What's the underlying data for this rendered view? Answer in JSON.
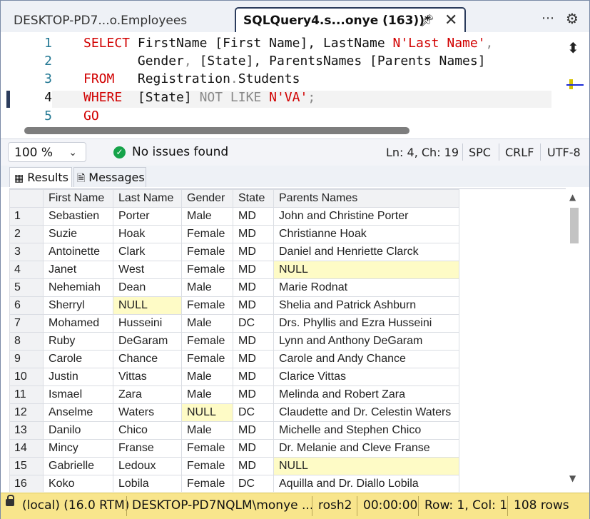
{
  "tabs": {
    "inactive": "DESKTOP-PD7...o.Employees",
    "active": "SQLQuery4.s...onye (163))*"
  },
  "editor": {
    "lines": [
      {
        "num": "1"
      },
      {
        "num": "2"
      },
      {
        "num": "3"
      },
      {
        "num": "4"
      },
      {
        "num": "5"
      }
    ],
    "code": {
      "l1_kw": "SELECT",
      "l1_a": "FirstName [First Name], LastName ",
      "l1_str": "N'Last Name'",
      "l1_comma": ",",
      "l2_a": "Gender",
      "l2_b": ", ",
      "l2_c": "[State], ParentsNames [Parents Names]",
      "l3_kw": "FROM",
      "l3_a": "Registration",
      "l3_dot": ".",
      "l3_b": "Students",
      "l4_kw": "WHERE",
      "l4_a": "[State] ",
      "l4_op": "NOT LIKE ",
      "l4_str": "N'VA'",
      "l4_semi": ";",
      "l5_kw": "GO"
    }
  },
  "status": {
    "zoom": "100 %",
    "issues": "No issues found",
    "position": "Ln: 4, Ch: 19",
    "spacing": "SPC",
    "line_ending": "CRLF",
    "encoding": "UTF-8"
  },
  "result_tabs": {
    "results": "Results",
    "messages": "Messages"
  },
  "grid": {
    "columns": [
      "First Name",
      "Last Name",
      "Gender",
      "State",
      "Parents Names"
    ],
    "rows": [
      [
        "1",
        "Sebastien",
        "Porter",
        "Male",
        "MD",
        "John and Christine Porter"
      ],
      [
        "2",
        "Suzie",
        "Hoak",
        "Female",
        "MD",
        "Christianne Hoak"
      ],
      [
        "3",
        "Antoinette",
        "Clark",
        "Female",
        "MD",
        "Daniel and Henriette Clarck"
      ],
      [
        "4",
        "Janet",
        "West",
        "Female",
        "MD",
        "NULL"
      ],
      [
        "5",
        "Nehemiah",
        "Dean",
        "Male",
        "MD",
        "Marie Rodnat"
      ],
      [
        "6",
        "Sherryl",
        "NULL",
        "Female",
        "MD",
        "Shelia and Patrick Ashburn"
      ],
      [
        "7",
        "Mohamed",
        "Husseini",
        "Male",
        "DC",
        "Drs. Phyllis and Ezra Husseini"
      ],
      [
        "8",
        "Ruby",
        "DeGaram",
        "Female",
        "MD",
        "Lynn and Anthony DeGaram"
      ],
      [
        "9",
        "Carole",
        "Chance",
        "Female",
        "MD",
        "Carole and Andy Chance"
      ],
      [
        "10",
        "Justin",
        "Vittas",
        "Male",
        "MD",
        "Clarice Vittas"
      ],
      [
        "11",
        "Ismael",
        "Zara",
        "Male",
        "MD",
        "Melinda and Robert Zara"
      ],
      [
        "12",
        "Anselme",
        "Waters",
        "NULL",
        "DC",
        "Claudette and Dr. Celestin Waters"
      ],
      [
        "13",
        "Danilo",
        "Chico",
        "Male",
        "MD",
        "Michelle and Stephen Chico"
      ],
      [
        "14",
        "Mincy",
        "Franse",
        "Female",
        "MD",
        "Dr. Melanie and Cleve Franse"
      ],
      [
        "15",
        "Gabrielle",
        "Ledoux",
        "Female",
        "MD",
        "NULL"
      ],
      [
        "16",
        "Koko",
        "Lobila",
        "Female",
        "DC",
        "Aquilla and Dr. Diallo Lobila"
      ]
    ]
  },
  "bottom": {
    "server": "(local) (16.0 RTM)",
    "login": "DESKTOP-PD7NQLM\\monye ...",
    "database": "rosh2",
    "time": "00:00:00",
    "rowcol": "Row: 1, Col: 1",
    "rows": "108 rows"
  },
  "colors": {
    "keyword": "#d10000",
    "null_cell": "#fefbc6",
    "status_bar": "#f8e58c",
    "ok": "#16a34a"
  }
}
